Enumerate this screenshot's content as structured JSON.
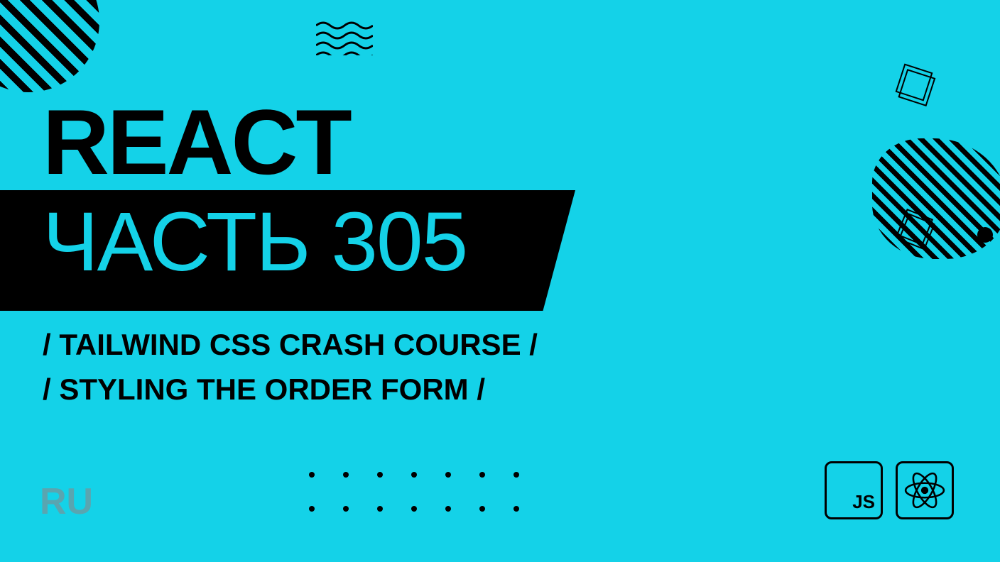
{
  "title": "REACT",
  "banner_text": "ЧАСТЬ 305",
  "subtitle_line1": "/ TAILWIND CSS CRASH COURSE /",
  "subtitle_line2": "/ STYLING THE ORDER FORM /",
  "language": "RU",
  "js_label": "JS",
  "colors": {
    "background": "#14d2e8",
    "foreground": "#000000",
    "muted": "#5aa5b0"
  },
  "icons": {
    "bottom_right": [
      "javascript-icon",
      "react-icon"
    ]
  }
}
